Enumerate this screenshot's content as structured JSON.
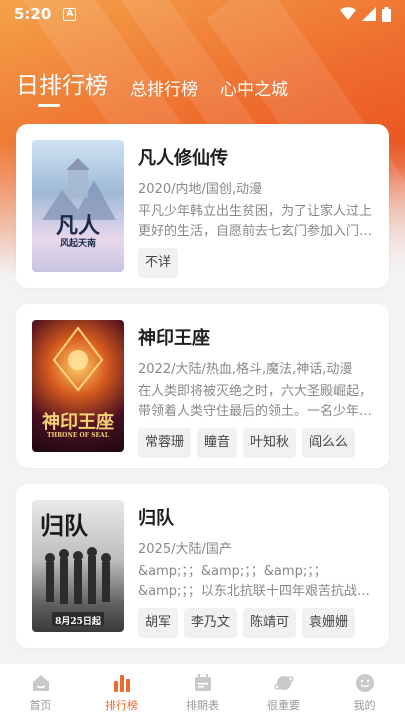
{
  "status": {
    "time": "5:20",
    "notification_icon": "A"
  },
  "tabs": [
    {
      "label": "日排行榜",
      "active": true
    },
    {
      "label": "总排行榜",
      "active": false
    },
    {
      "label": "心中之城",
      "active": false
    }
  ],
  "colors": {
    "accent": "#ee6a2c",
    "background": "#f3f3f5"
  },
  "cards": [
    {
      "title": "凡人修仙传",
      "meta": "2020/内地/国创,动漫",
      "desc": "平凡少年韩立出生贫困，为了让家人过上更好的生活，自愿前去七玄门参加入门…",
      "tags": [
        "不详"
      ],
      "poster_text": [
        "凡人",
        "风起天南"
      ]
    },
    {
      "title": "神印王座",
      "meta": "2022/大陆/热血,格斗,魔法,神话,动漫",
      "desc": "在人类即将被灭绝之时，六大圣殿崛起，带领着人类守住最后的领土。一名少年…",
      "tags": [
        "常蓉珊",
        "瞳音",
        "叶知秋",
        "阎么么"
      ],
      "poster_text": [
        "神印王座",
        "THRONE OF SEAL"
      ]
    },
    {
      "title": "归队",
      "meta": "2025/大陆/国产",
      "desc": "&amp;；；&amp;；；&amp;；；&amp;；；以东北抗联十四年艰苦抗战…",
      "tags": [
        "胡军",
        "李乃文",
        "陈靖可",
        "袁姗姗"
      ],
      "poster_text": [
        "归队",
        "8月25日起"
      ]
    }
  ],
  "nav": [
    {
      "label": "首页",
      "icon": "home-icon",
      "active": false
    },
    {
      "label": "排行榜",
      "icon": "bar-chart-icon",
      "active": true
    },
    {
      "label": "排期表",
      "icon": "calendar-icon",
      "active": false
    },
    {
      "label": "很重要",
      "icon": "planet-icon",
      "active": false
    },
    {
      "label": "我的",
      "icon": "smiley-icon",
      "active": false
    }
  ]
}
